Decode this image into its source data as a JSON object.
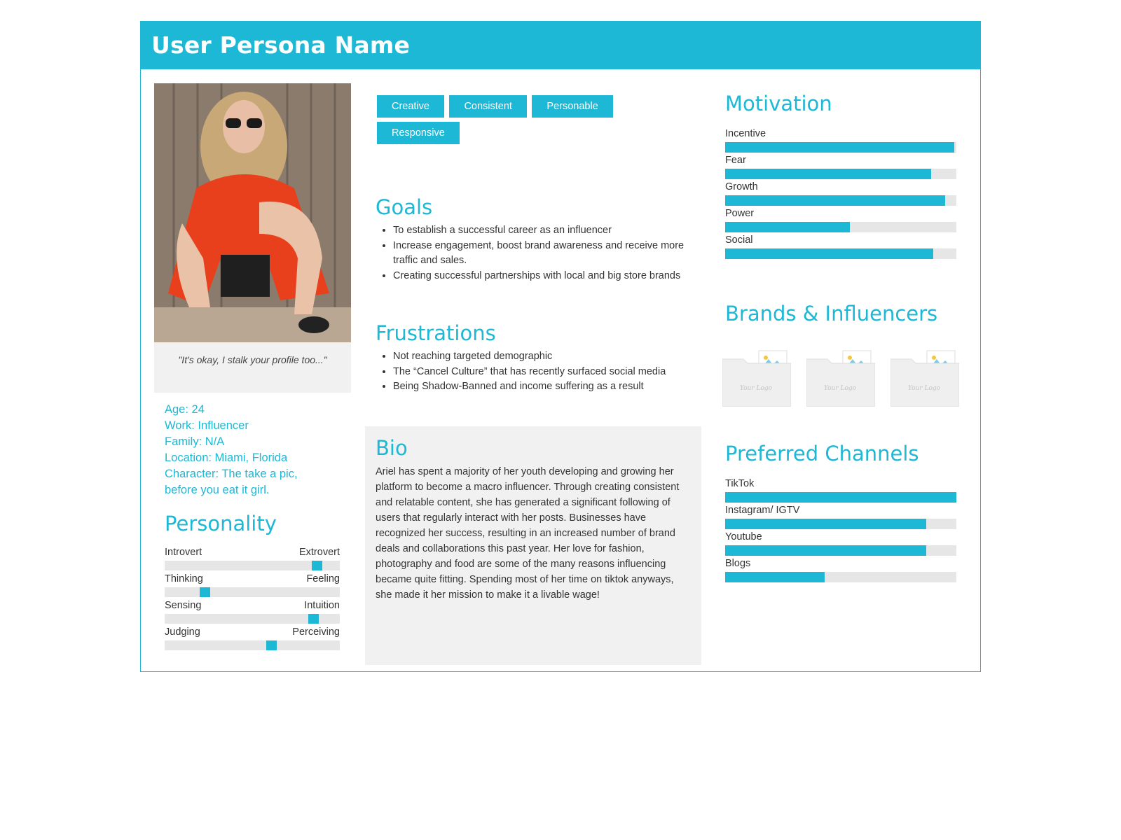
{
  "header": {
    "title": "User Persona Name"
  },
  "profile": {
    "quote": "\"It's okay, I stalk your profile too...\"",
    "age": "Age: 24",
    "work": "Work: Influencer",
    "family": "Family: N/A",
    "location": "Location: Miami, Florida",
    "character_line1": "Character: The take a pic,",
    "character_line2": "before you eat it girl."
  },
  "personality": {
    "title": "Personality",
    "traits": [
      {
        "left": "Introvert",
        "right": "Extrovert",
        "value": 0.87
      },
      {
        "left": "Thinking",
        "right": "Feeling",
        "value": 0.23
      },
      {
        "left": "Sensing",
        "right": "Intuition",
        "value": 0.85
      },
      {
        "left": "Judging",
        "right": "Perceiving",
        "value": 0.61
      }
    ]
  },
  "tags": [
    "Creative",
    "Consistent",
    "Personable",
    "Responsive"
  ],
  "goals": {
    "title": "Goals",
    "items": [
      "To establish a successful career as an influencer",
      "Increase engagement, boost brand awareness and receive more traffic and sales.",
      "Creating successful partnerships with local and big store brands"
    ]
  },
  "frustrations": {
    "title": "Frustrations",
    "items": [
      "Not reaching targeted demographic",
      "The “Cancel Culture” that has recently surfaced social media",
      "Being Shadow-Banned and income suffering as a result"
    ]
  },
  "bio": {
    "title": "Bio",
    "text": "Ariel has spent a majority of her youth developing and growing her platform to become a macro influencer. Through creating consistent and relatable content, she has generated a significant following of users that regularly interact with her posts. Businesses have recognized her success, resulting in an increased number of brand deals and collaborations this past year. Her love for fashion, photography and food are some of the many reasons influencing became quite fitting. Spending most of her time on tiktok anyways, she made it her mission to make it a livable wage!"
  },
  "motivation": {
    "title": "Motivation",
    "items": [
      {
        "label": "Incentive",
        "value": 0.99
      },
      {
        "label": "Fear",
        "value": 0.89
      },
      {
        "label": "Growth",
        "value": 0.95
      },
      {
        "label": "Power",
        "value": 0.54
      },
      {
        "label": "Social",
        "value": 0.9
      }
    ]
  },
  "brands": {
    "title": "Brands & Influencers",
    "placeholder_text": "Your Logo",
    "count": 3
  },
  "channels": {
    "title": "Preferred Channels",
    "items": [
      {
        "label": "TikTok",
        "value": 1.0
      },
      {
        "label": "Instagram/ IGTV",
        "value": 0.87
      },
      {
        "label": "Youtube",
        "value": 0.87
      },
      {
        "label": "Blogs",
        "value": 0.43
      }
    ]
  },
  "colors": {
    "accent": "#1cb8d6",
    "panel": "#f1f1f1",
    "track": "#e6e6e6"
  }
}
